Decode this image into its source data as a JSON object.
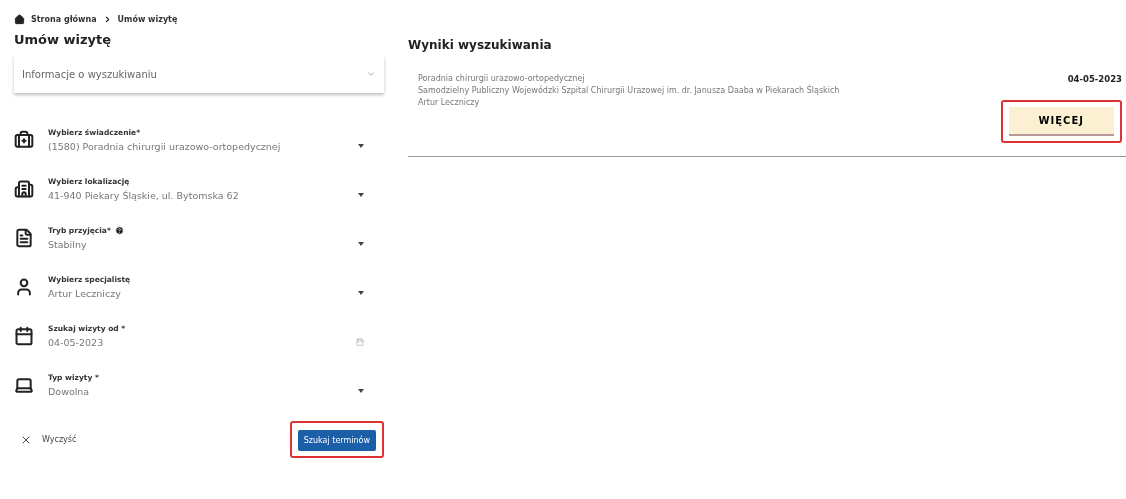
{
  "breadcrumb": [
    {
      "label": "Strona główna"
    },
    {
      "label": "Umów wizytę"
    }
  ],
  "form": {
    "title": "Umów wizytę",
    "search_info": "Informacje o wyszukiwaniu",
    "fields": [
      {
        "kind": "select",
        "label": "Wybierz świadczenie*",
        "value": "(1580) Poradnia chirurgii urazowo-ortopedycznej",
        "help": false
      },
      {
        "kind": "select",
        "label": "Wybierz lokalizację",
        "value": "41-940 Piekary Śląskie, ul. Bytomska 62",
        "help": false
      },
      {
        "kind": "select",
        "label": "Tryb przyjęcia*",
        "value": "Stabilny",
        "help": true
      },
      {
        "kind": "select",
        "label": "Wybierz specjalistę",
        "value": "Artur Leczniczy",
        "help": false
      },
      {
        "kind": "date",
        "label": "Szukaj wizyty od *",
        "value": "04-05-2023",
        "help": false
      },
      {
        "kind": "select",
        "label": "Typ wizyty *",
        "value": "Dowolna",
        "help": false
      }
    ],
    "clear": "Wyczyść",
    "submit": "Szukaj terminów",
    "submit_highlighted": true
  },
  "results": {
    "title": "Wyniki wyszukiwania",
    "items": [
      {
        "clinic": "Poradnia chirurgii urazowo-ortopedycznej",
        "hospital": "Samodzielny Publiczny Wojewódzki Szpital Chirurgii Urazowej im. dr. Janusza Daaba w Piekarach Śląskich",
        "doctor": "Artur Leczniczy",
        "date": "04-05-2023",
        "button": "WIĘCEJ",
        "highlighted": true
      }
    ]
  }
}
